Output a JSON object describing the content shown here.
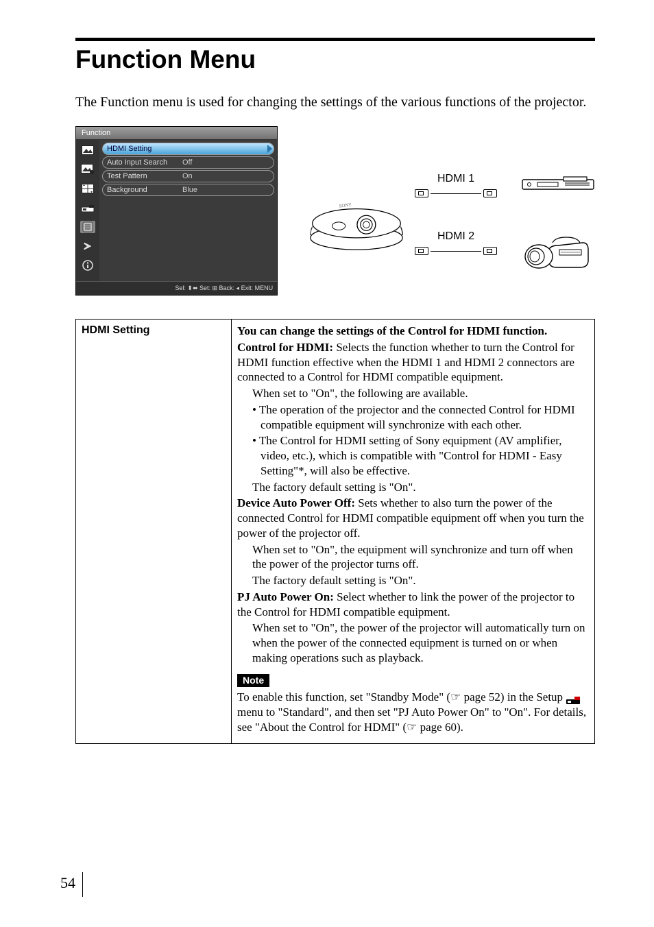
{
  "title": "Function Menu",
  "intro": "The Function menu is used for changing the settings of the various functions of the projector.",
  "menu": {
    "title": "Function",
    "rows": [
      {
        "label": "HDMI Setting",
        "value": "",
        "selected": true
      },
      {
        "label": "Auto Input Search",
        "value": "Off",
        "selected": false
      },
      {
        "label": "Test Pattern",
        "value": "On",
        "selected": false
      },
      {
        "label": "Background",
        "value": "Blue",
        "selected": false
      }
    ],
    "footer": "Sel: ⬍⬌   Set: ⊞   Back: ◂   Exit: MENU"
  },
  "hdmi": {
    "port1": "HDMI 1",
    "port2": "HDMI 2"
  },
  "table": {
    "key": "HDMI Setting",
    "lead": "You can change the settings of the Control for HDMI function.",
    "cfh_label": "Control for HDMI:",
    "cfh_1": " Selects the function whether to turn the Control for HDMI function effective when the HDMI 1 and HDMI 2 connectors are connected to a Control for HDMI compatible equipment.",
    "cfh_2": "When set to \"On\", the following are available.",
    "cfh_b1": "• The operation of the projector and the connected Control for HDMI compatible equipment will synchronize with each other.",
    "cfh_b2": "• The Control for HDMI setting of Sony equipment (AV amplifier, video, etc.), which is compatible with \"Control for HDMI - Easy Setting\"*, will also be effective.",
    "cfh_3": "The factory default setting is \"On\".",
    "dapo_label": "Device Auto Power Off:",
    "dapo_1": " Sets whether to also turn the power of the connected Control for HDMI compatible equipment off when you turn the power of the projector off.",
    "dapo_2": "When set to \"On\", the equipment will synchronize and turn off when the power of the projector turns off.",
    "dapo_3": "The factory default setting is \"On\".",
    "pjapo_label": "PJ Auto Power On:",
    "pjapo_1": " Select whether to link the power of the projector to the Control for HDMI compatible equipment.",
    "pjapo_2": "When set to \"On\", the power of the projector will automatically turn on when the power of the connected equipment is turned on or when making operations such as playback.",
    "note_label": "Note",
    "note_1a": "To enable this function, set \"Standby Mode\" (☞ page 52) in the Setup ",
    "note_1b": " menu to \"Standard\", and then set \"PJ Auto Power On\" to \"On\". For details, see \"About the Control for HDMI\" (☞ page 60)."
  },
  "page_number": "54"
}
